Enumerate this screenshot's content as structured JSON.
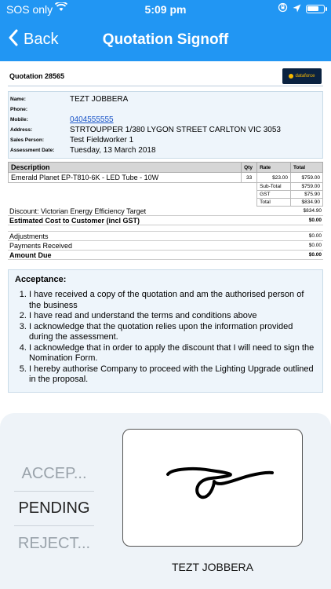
{
  "status_bar": {
    "carrier": "SOS only",
    "time": "5:09 pm"
  },
  "nav": {
    "back_label": "Back",
    "title": "Quotation Signoff"
  },
  "quotation": {
    "number_label": "Quotation 28565",
    "logo_text": "dataforce",
    "customer": [
      {
        "label": "Name:",
        "value": "TEZT JOBBERA",
        "link": false
      },
      {
        "label": "Phone:",
        "value": "",
        "link": false
      },
      {
        "label": "Mobile:",
        "value": "0404555555",
        "link": true
      },
      {
        "label": "Address:",
        "value": "STRTOUPPER 1/380 LYGON STREET CARLTON VIC 3053",
        "link": false
      },
      {
        "label": "Sales Person:",
        "value": "Test Fieldworker 1",
        "link": false
      },
      {
        "label": "Assessment Date:",
        "value": "Tuesday, 13 March 2018",
        "link": false
      }
    ],
    "table": {
      "headers": {
        "description": "Description",
        "qty": "Qty",
        "rate": "Rate",
        "total": "Total"
      },
      "items": [
        {
          "description": "Emerald Planet EP-T810-6K - LED Tube - 10W",
          "qty": "33",
          "rate": "$23.00",
          "total": "$759.00"
        }
      ],
      "summary": [
        {
          "label": "Sub-Total",
          "value": "$759.00"
        },
        {
          "label": "GST",
          "value": "$75.90"
        },
        {
          "label": "Total",
          "value": "$834.90"
        }
      ]
    },
    "discount": {
      "label": "Discount: Victorian Energy Efficiency Target",
      "value": "$834.90"
    },
    "estimated": {
      "label": "Estimated Cost to Customer (incl GST)",
      "value": "$0.00"
    },
    "adjustments": {
      "label": "Adjustments",
      "value": "$0.00"
    },
    "payments": {
      "label": "Payments Received",
      "value": "$0.00"
    },
    "amount_due": {
      "label": "Amount Due",
      "value": "$0.00"
    },
    "acceptance": {
      "title": "Acceptance:",
      "items": [
        "I have received a copy of the quotation and am the authorised person of the business",
        "I have read and understand the terms and conditions above",
        "I acknowledge that the quotation relies upon the information provided during the assessment.",
        "I acknowledge that in order to apply the discount that I will need to sign the Nomination Form.",
        "I hereby authorise Company to proceed with the Lighting Upgrade outlined in the proposal."
      ]
    }
  },
  "signoff": {
    "options": [
      {
        "label": "ACCEP...",
        "state": "dim"
      },
      {
        "label": "PENDING",
        "state": "sel"
      },
      {
        "label": "REJECT...",
        "state": "dim"
      }
    ],
    "signer_name": "TEZT JOBBERA"
  }
}
